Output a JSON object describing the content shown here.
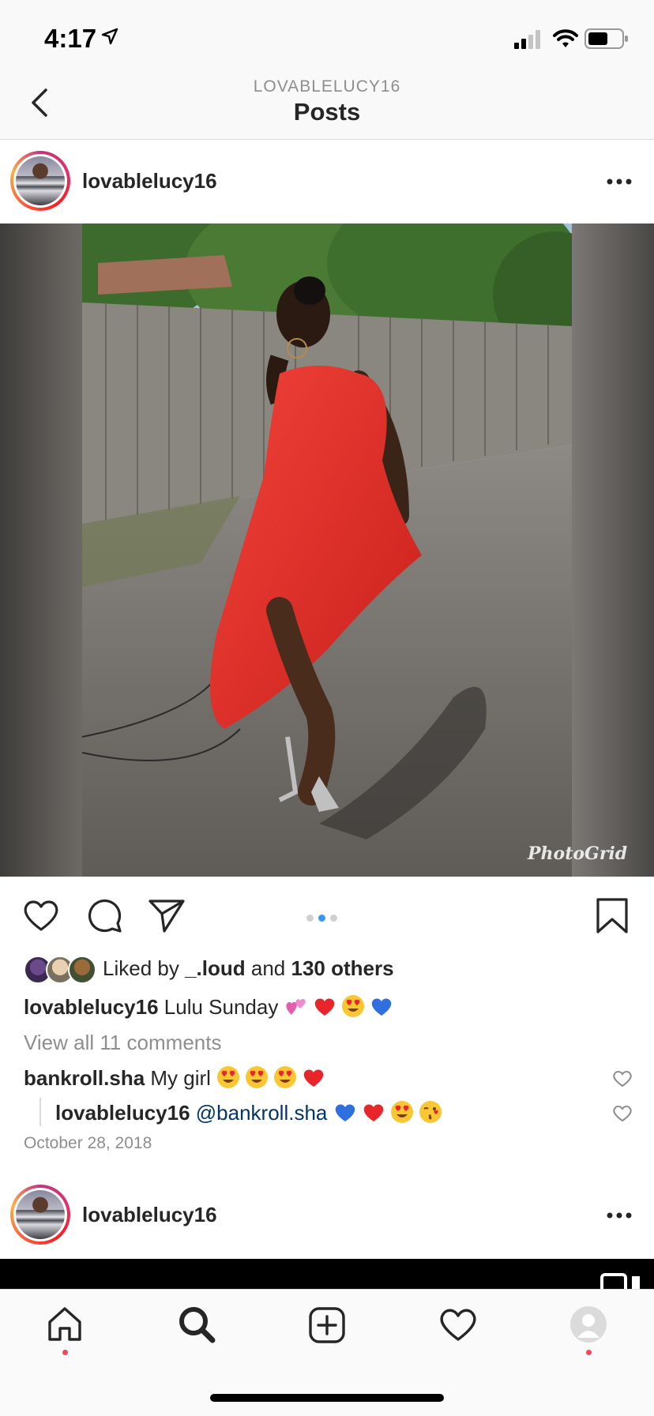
{
  "status_bar": {
    "time": "4:17"
  },
  "header": {
    "username": "LOVABLELUCY16",
    "title": "Posts"
  },
  "post": {
    "username": "lovablelucy16",
    "watermark": "PhotoGrid",
    "carousel": {
      "count": 3,
      "active": 2
    },
    "likes": {
      "prefix": "Liked by",
      "user": "_.loud",
      "joiner": "and",
      "count_text": "130 others"
    },
    "caption": {
      "user": "lovablelucy16",
      "text": "Lulu Sunday"
    },
    "view_comments": "View all 11 comments",
    "comments": [
      {
        "user": "bankroll.sha",
        "text": "My girl"
      },
      {
        "user": "lovablelucy16",
        "mention": "@bankroll.sha"
      }
    ],
    "date": "October 28, 2018"
  },
  "next_post": {
    "username": "lovablelucy16"
  },
  "colors": {
    "accent": "#3897f0",
    "notification": "#ed4956",
    "mention": "#003569"
  }
}
